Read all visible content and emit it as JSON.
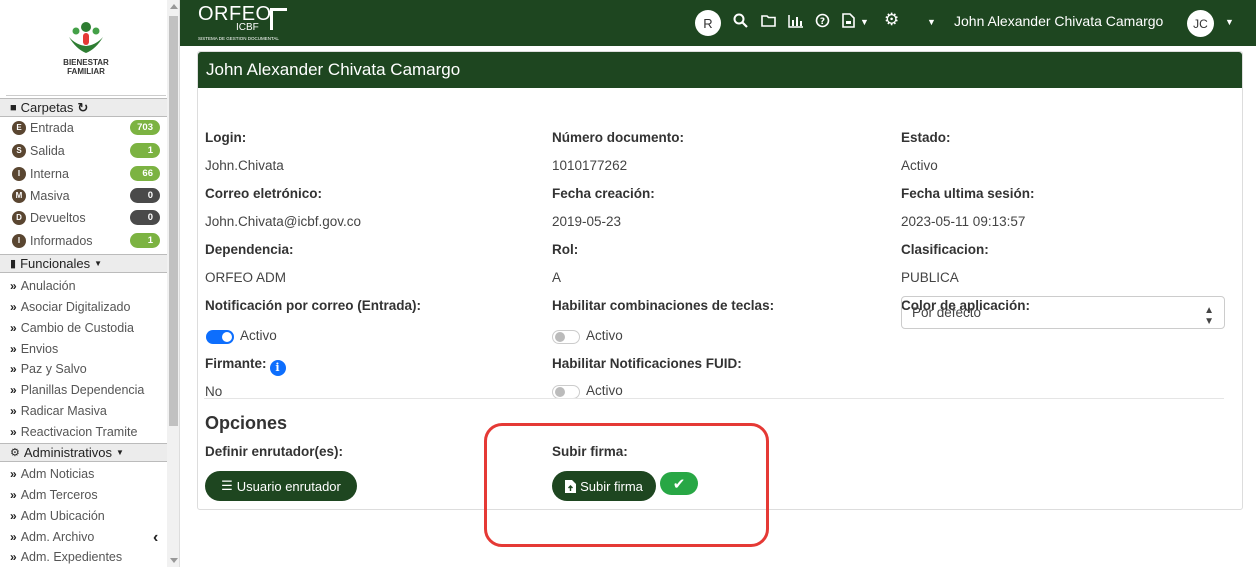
{
  "sidebar": {
    "logo_text_1": "BIENESTAR",
    "logo_text_2": "FAMILIAR",
    "carpetas_label": "Carpetas",
    "folders": [
      {
        "letter": "E",
        "label": "Entrada",
        "count": "703",
        "color": "green"
      },
      {
        "letter": "S",
        "label": "Salida",
        "count": "1",
        "color": "green"
      },
      {
        "letter": "I",
        "label": "Interna",
        "count": "66",
        "color": "green"
      },
      {
        "letter": "M",
        "label": "Masiva",
        "count": "0",
        "color": "dark"
      },
      {
        "letter": "D",
        "label": "Devueltos",
        "count": "0",
        "color": "dark"
      },
      {
        "letter": "I",
        "label": "Informados",
        "count": "1",
        "color": "green"
      }
    ],
    "funcionales_label": "Funcionales",
    "funcionales_items": [
      "Anulación",
      "Asociar Digitalizado",
      "Cambio de Custodia",
      "Envios",
      "Paz y Salvo",
      "Planillas Dependencia",
      "Radicar Masiva",
      "Reactivacion Tramite"
    ],
    "administrativos_label": "Administrativos",
    "administrativos_items": [
      "Adm Noticias",
      "Adm Terceros",
      "Adm Ubicación",
      "Adm. Archivo",
      "Adm. Expedientes"
    ]
  },
  "topbar": {
    "brand": "ORFEO",
    "brand_sub": "ICBF",
    "brand_tag": "SISTEMA DE GESTION DOCUMENTAL",
    "avatar_r": "R",
    "user_name": "John Alexander Chivata Camargo",
    "user_initials": "JC"
  },
  "profile": {
    "title": "John Alexander Chivata Camargo",
    "login_label": "Login:",
    "login": "John.Chivata",
    "numdoc_label": "Número documento:",
    "numdoc": "1010177262",
    "estado_label": "Estado:",
    "estado": "Activo",
    "correo_label": "Correo eletrónico:",
    "correo": "John.Chivata@icbf.gov.co",
    "fecha_creacion_label": "Fecha creación:",
    "fecha_creacion": "2019-05-23",
    "fecha_sesion_label": "Fecha ultima sesión:",
    "fecha_sesion": "2023-05-11 09:13:57",
    "dependencia_label": "Dependencia:",
    "dependencia": "ORFEO ADM",
    "rol_label": "Rol:",
    "rol": "A",
    "clasificacion_label": "Clasificacion:",
    "clasificacion": "PUBLICA",
    "notif_label": "Notificación por correo (Entrada):",
    "notif_value": "Activo",
    "teclas_label": "Habilitar combinaciones de teclas:",
    "teclas_value": "Activo",
    "color_label": "Color de aplicación:",
    "color_value": "Por defecto",
    "firmante_label": "Firmante:",
    "firmante": "No",
    "fuid_label": "Habilitar Notificaciones FUID:",
    "fuid_value": "Activo"
  },
  "opciones": {
    "title": "Opciones",
    "enrutador_label": "Definir enrutador(es):",
    "enrutador_button": "Usuario enrutador",
    "firma_label": "Subir firma:",
    "firma_button": "Subir firma"
  }
}
